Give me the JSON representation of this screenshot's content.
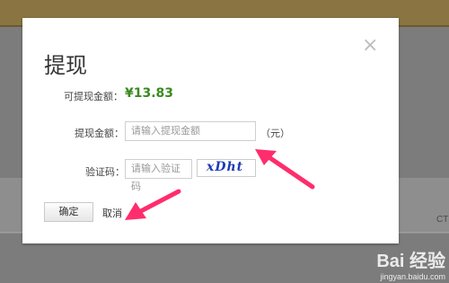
{
  "background": {
    "right_cut_text": "CTI"
  },
  "dialog": {
    "title": "提现",
    "close_glyph": "×",
    "available_label": "可提现金额：",
    "available_amount": "¥13.83",
    "amount_label": "提现金额：",
    "amount_placeholder": "请输入提现金额",
    "amount_unit": "（元）",
    "captcha_label": "验证码：",
    "captcha_placeholder": "请输入验证码",
    "captcha_text": "xDht",
    "confirm_label": "确定",
    "cancel_label": "取消"
  },
  "watermark": {
    "logo": "Bai 经验",
    "url": "jingyan.baidu.com"
  },
  "colors": {
    "amount": "#3a8a1f",
    "arrow": "#ff2d6d",
    "captcha": "#1f3bb5"
  }
}
